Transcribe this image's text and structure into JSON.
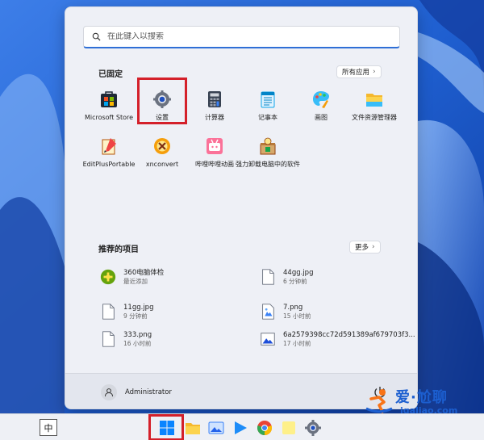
{
  "search": {
    "placeholder": "在此键入以搜索"
  },
  "pinned": {
    "title": "已固定",
    "all_apps_label": "所有应用",
    "apps": [
      {
        "label": "Microsoft Store",
        "icon": "microsoft-store-icon"
      },
      {
        "label": "设置",
        "icon": "settings-gear-icon"
      },
      {
        "label": "计算器",
        "icon": "calculator-icon"
      },
      {
        "label": "记事本",
        "icon": "notepad-icon"
      },
      {
        "label": "画图",
        "icon": "paint-icon"
      },
      {
        "label": "文件资源管理器",
        "icon": "file-explorer-icon"
      },
      {
        "label": "EditPlusPortable",
        "icon": "editplus-icon"
      },
      {
        "label": "xnconvert",
        "icon": "xnconvert-icon"
      },
      {
        "label": "哔哩哔哩动画",
        "icon": "bilibili-icon"
      },
      {
        "label": "强力卸载电脑中的软件",
        "icon": "uninstaller-icon"
      }
    ]
  },
  "recommended": {
    "title": "推荐的项目",
    "more_label": "更多",
    "items": [
      {
        "name": "360电脑体检",
        "time": "最近添加",
        "icon": "360-checkup-icon"
      },
      {
        "name": "44gg.jpg",
        "time": "6 分钟前",
        "icon": "file-icon"
      },
      {
        "name": "11gg.jpg",
        "time": "9 分钟前",
        "icon": "file-icon"
      },
      {
        "name": "7.png",
        "time": "15 小时前",
        "icon": "image-file-icon"
      },
      {
        "name": "333.png",
        "time": "16 小时前",
        "icon": "file-icon"
      },
      {
        "name": "6a2579398cc72d591389af679703f3...",
        "time": "17 小时前",
        "icon": "image-file-icon"
      }
    ]
  },
  "footer": {
    "user_name": "Administrator"
  },
  "taskbar": {
    "ime_label": "中",
    "icons": [
      "start-icon",
      "file-explorer-icon",
      "photos-icon",
      "media-player-icon",
      "chrome-icon",
      "sticky-notes-icon",
      "settings-icon"
    ]
  },
  "watermark": {
    "brand": "爱·尬聊",
    "site": "igaliao.com"
  },
  "colors": {
    "accent": "#2f6fd6",
    "highlight": "#d4202a",
    "menu_bg": "#eef0f6"
  }
}
